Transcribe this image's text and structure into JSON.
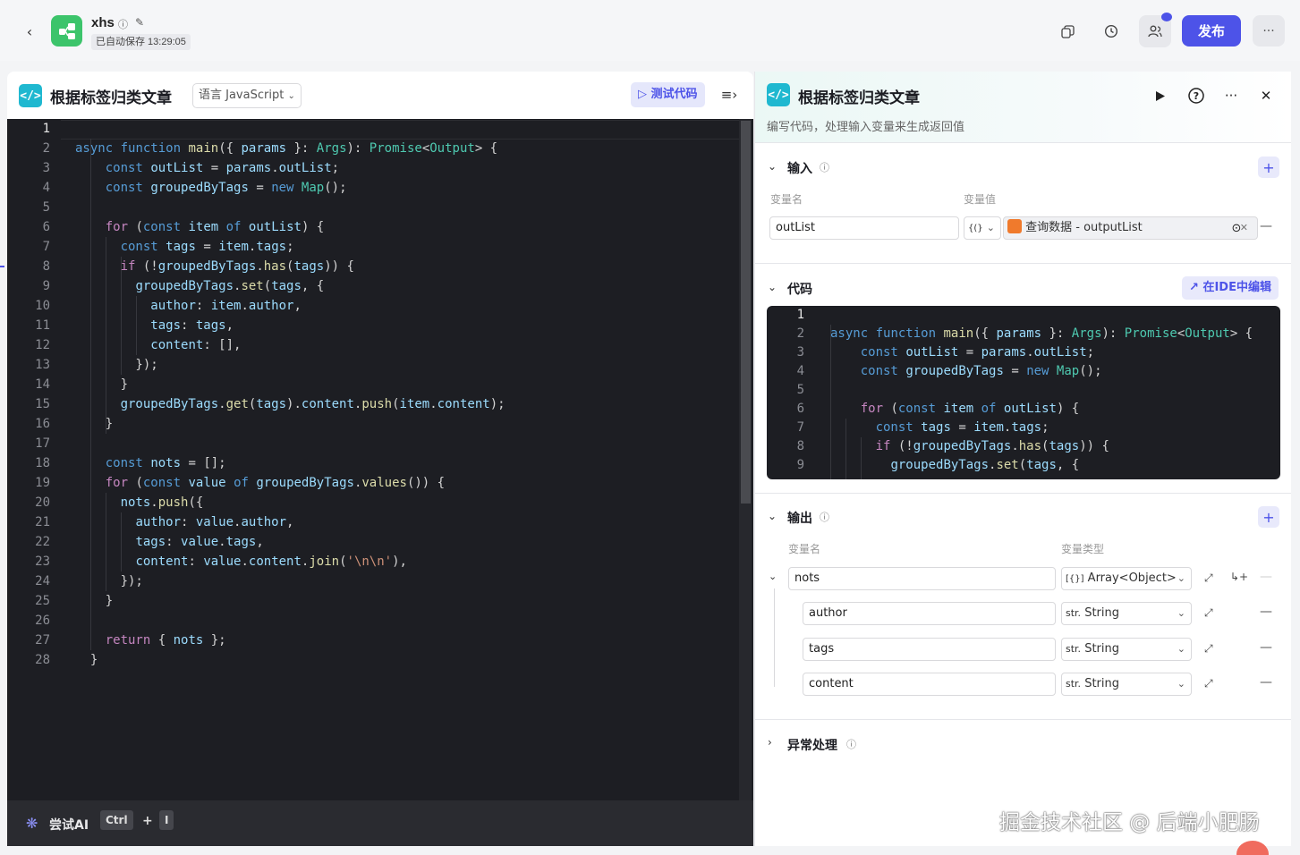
{
  "topbar": {
    "app_name": "xhs",
    "save_status": "已自动保存 13:29:05",
    "publish_label": "发布"
  },
  "left": {
    "title": "根据标签归类文章",
    "language_select": "语言 JavaScript",
    "test_code_label": "测试代码",
    "ai_label": "尝试AI",
    "shortcut_key1": "Ctrl",
    "shortcut_plus": "+",
    "shortcut_key2": "I"
  },
  "right": {
    "title": "根据标签归类文章",
    "description": "编写代码，处理输入变量来生成返回值",
    "input": {
      "section_title": "输入",
      "col_name": "变量名",
      "col_value": "变量值",
      "var_name": "outList",
      "value_source": "查询数据 - outputList"
    },
    "code": {
      "section_title": "代码",
      "ide_edit_label": "在IDE中编辑"
    },
    "output": {
      "section_title": "输出",
      "col_name": "变量名",
      "col_type": "变量类型",
      "vars": [
        {
          "name": "nots",
          "type": "Array<Object>"
        },
        {
          "name": "author",
          "type": "String"
        },
        {
          "name": "tags",
          "type": "String"
        },
        {
          "name": "content",
          "type": "String"
        }
      ]
    },
    "exception": {
      "section_title": "异常处理"
    }
  },
  "editor": {
    "line_numbers": [
      "1",
      "2",
      "3",
      "4",
      "5",
      "6",
      "7",
      "8",
      "9",
      "10",
      "11",
      "12",
      "13",
      "14",
      "15",
      "16",
      "17",
      "18",
      "19",
      "20",
      "21",
      "22",
      "23",
      "24",
      "25",
      "26",
      "27",
      "28"
    ],
    "mini_line_numbers": [
      "1",
      "2",
      "3",
      "4",
      "5",
      "6",
      "7",
      "8",
      "9"
    ]
  },
  "watermark": "掘金技术社区 @ 后端小肥肠"
}
